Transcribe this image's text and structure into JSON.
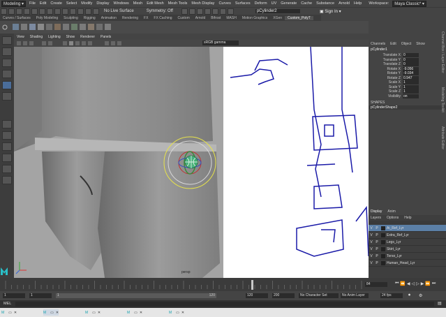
{
  "menubar": {
    "items": [
      "File",
      "Edit",
      "Create",
      "Select",
      "Modify",
      "Display",
      "Windows",
      "Mesh",
      "Edit Mesh",
      "Mesh Tools",
      "Mesh Display",
      "Curves",
      "Surfaces",
      "Deform",
      "UV",
      "Generate",
      "Cache",
      "Substance",
      "Arnold",
      "Help"
    ],
    "workspace_label": "Workspace:",
    "workspace_value": "Maya Classic*"
  },
  "statusline": {
    "mode": "Modeling",
    "live_surface": "No Live Surface",
    "symmetry": "Symmetry: Off",
    "object_field": "pCylinder2",
    "sign_in": "Sign In"
  },
  "shelf": {
    "tabs": [
      "Curves / Surfaces",
      "Poly Modeling",
      "Sculpting",
      "Rigging",
      "Animation",
      "Rendering",
      "FX",
      "FX Caching",
      "Custom",
      "Arnold",
      "Bifrost",
      "MASH",
      "Motion Graphics",
      "XGen",
      "Custom_PolyT"
    ],
    "active": 14
  },
  "viewport": {
    "menu": [
      "View",
      "Shading",
      "Lighting",
      "Show",
      "Renderer",
      "Panels"
    ],
    "colorspace": "sRGB gamma",
    "camera_label": "persp"
  },
  "channelbox": {
    "tabs": [
      "Channels",
      "Edit",
      "Object",
      "Show"
    ],
    "object_name": "pCylinder1",
    "attributes": [
      {
        "name": "Translate X",
        "value": "0"
      },
      {
        "name": "Translate Y",
        "value": "0"
      },
      {
        "name": "Translate Z",
        "value": "0"
      },
      {
        "name": "Rotate X",
        "value": "-9.056"
      },
      {
        "name": "Rotate Y",
        "value": "-9.034"
      },
      {
        "name": "Rotate Z",
        "value": "0.947"
      },
      {
        "name": "Scale X",
        "value": "1"
      },
      {
        "name": "Scale Y",
        "value": "1"
      },
      {
        "name": "Scale Z",
        "value": "1"
      },
      {
        "name": "Visibility",
        "value": "on"
      }
    ],
    "shapes_header": "SHAPES",
    "shape_name": "pCylinderShape2"
  },
  "side_tabs": [
    "Channel Box / Layer Editor",
    "Modeling Toolkit",
    "Attribute Editor"
  ],
  "layer_editor": {
    "tabs": [
      "Display",
      "Anim"
    ],
    "menu": [
      "Layers",
      "Options",
      "Help"
    ],
    "layers": [
      {
        "v": "V",
        "p": "P",
        "name": "Ai_Ref_Lyr",
        "selected": true
      },
      {
        "v": "V",
        "p": "P",
        "name": "Extra_Ref_Lyr",
        "selected": false
      },
      {
        "v": "V",
        "p": "P",
        "name": "Legs_Lyr",
        "selected": false
      },
      {
        "v": "V",
        "p": "P",
        "name": "Skirt_Lyr",
        "selected": false
      },
      {
        "v": "V",
        "p": "P",
        "name": "Torso_Lyr",
        "selected": false
      },
      {
        "v": "V",
        "p": "P",
        "name": "Human_Head_Lyr",
        "selected": false
      }
    ]
  },
  "timeline": {
    "current_frame": "84",
    "end_label": "84"
  },
  "range": {
    "start": "1",
    "start2": "1",
    "range_start_handle": "1",
    "range_end_handle": "120",
    "end": "120",
    "end2": "200",
    "character_set": "No Character Set",
    "anim_layer": "No Anim Layer",
    "fps": "24 fps"
  },
  "cmdline": {
    "label": "MEL"
  },
  "taskbar": {
    "windows": [
      "M",
      "M",
      "M",
      "M",
      "M"
    ]
  },
  "colors": {
    "accent": "#4a6d9a",
    "selected_layer": "#5b7fa6",
    "viewport_bg": "#ffffff",
    "line_art": "#1a1aa8"
  }
}
